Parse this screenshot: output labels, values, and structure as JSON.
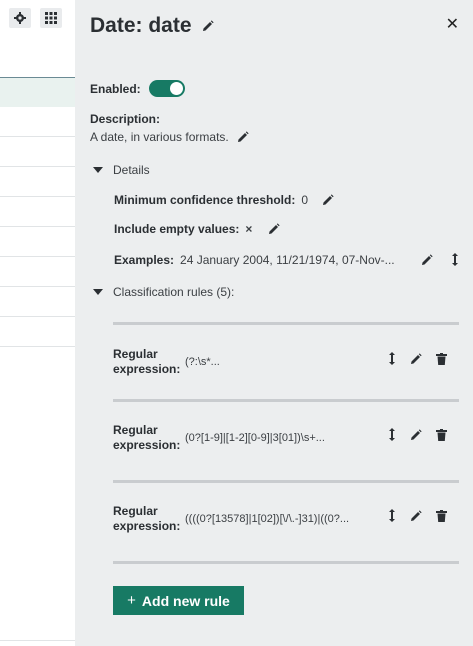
{
  "panel": {
    "title": "Date: date",
    "enabled_label": "Enabled:",
    "description_label": "Description:",
    "description_value": "A date, in various formats.",
    "details_label": "Details",
    "min_conf_label": "Minimum confidence threshold:",
    "min_conf_value": "0",
    "include_empty_label": "Include empty values:",
    "include_empty_value": "×",
    "examples_label": "Examples:",
    "examples_value": "24 January 2004, 11/21/1974, 07-Nov-...",
    "rules_label": "Classification rules (5):",
    "add_rule_label": "Add new rule"
  },
  "rules": [
    {
      "label_line1": "Regular",
      "label_line2": "expression:",
      "value": "(?:\\s*..."
    },
    {
      "label_line1": "Regular",
      "label_line2": "expression:",
      "value": "(0?[1-9]|[1-2][0-9]|3[01])\\s+..."
    },
    {
      "label_line1": "Regular",
      "label_line2": "expression:",
      "value": "((((0?[13578]|1[02])[\\/\\.-]31)|((0?..."
    }
  ],
  "colors": {
    "accent": "#177a64",
    "panel_bg": "#eceeef"
  },
  "icons": [
    "gear-icon",
    "grid-icon",
    "pencil-icon",
    "close-icon",
    "sort-icon",
    "trash-icon",
    "chevron-down-icon",
    "plus-icon"
  ]
}
